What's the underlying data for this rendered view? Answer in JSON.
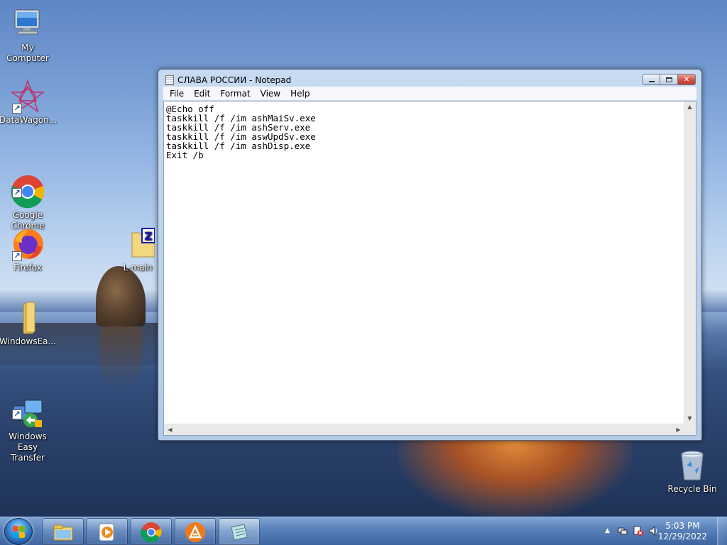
{
  "desktop": {
    "icons": [
      {
        "label": "My Computer"
      },
      {
        "label": "DataWagon..."
      },
      {
        "label": "Google\nChrome"
      },
      {
        "label": "Firefox"
      },
      {
        "label": "WindowsEa..."
      },
      {
        "label": "Windows\nEasy Transfer"
      },
      {
        "label": "L-main"
      },
      {
        "label": "Recycle Bin"
      }
    ]
  },
  "notepad": {
    "title": "СЛАВА РОССИИ - Notepad",
    "menu": [
      "File",
      "Edit",
      "Format",
      "View",
      "Help"
    ],
    "content": "@Echo off\ntaskkill /f /im ashMaiSv.exe\ntaskkill /f /im ashServ.exe\ntaskkill /f /im aswUpdSv.exe\ntaskkill /f /im ashDisp.exe\nExit /b"
  },
  "taskbar": {
    "time": "5:03 PM",
    "date": "12/29/2022",
    "tray_chevron": "▲"
  },
  "colors": {
    "accent": "#3f8fd8",
    "close": "#c0392b"
  }
}
